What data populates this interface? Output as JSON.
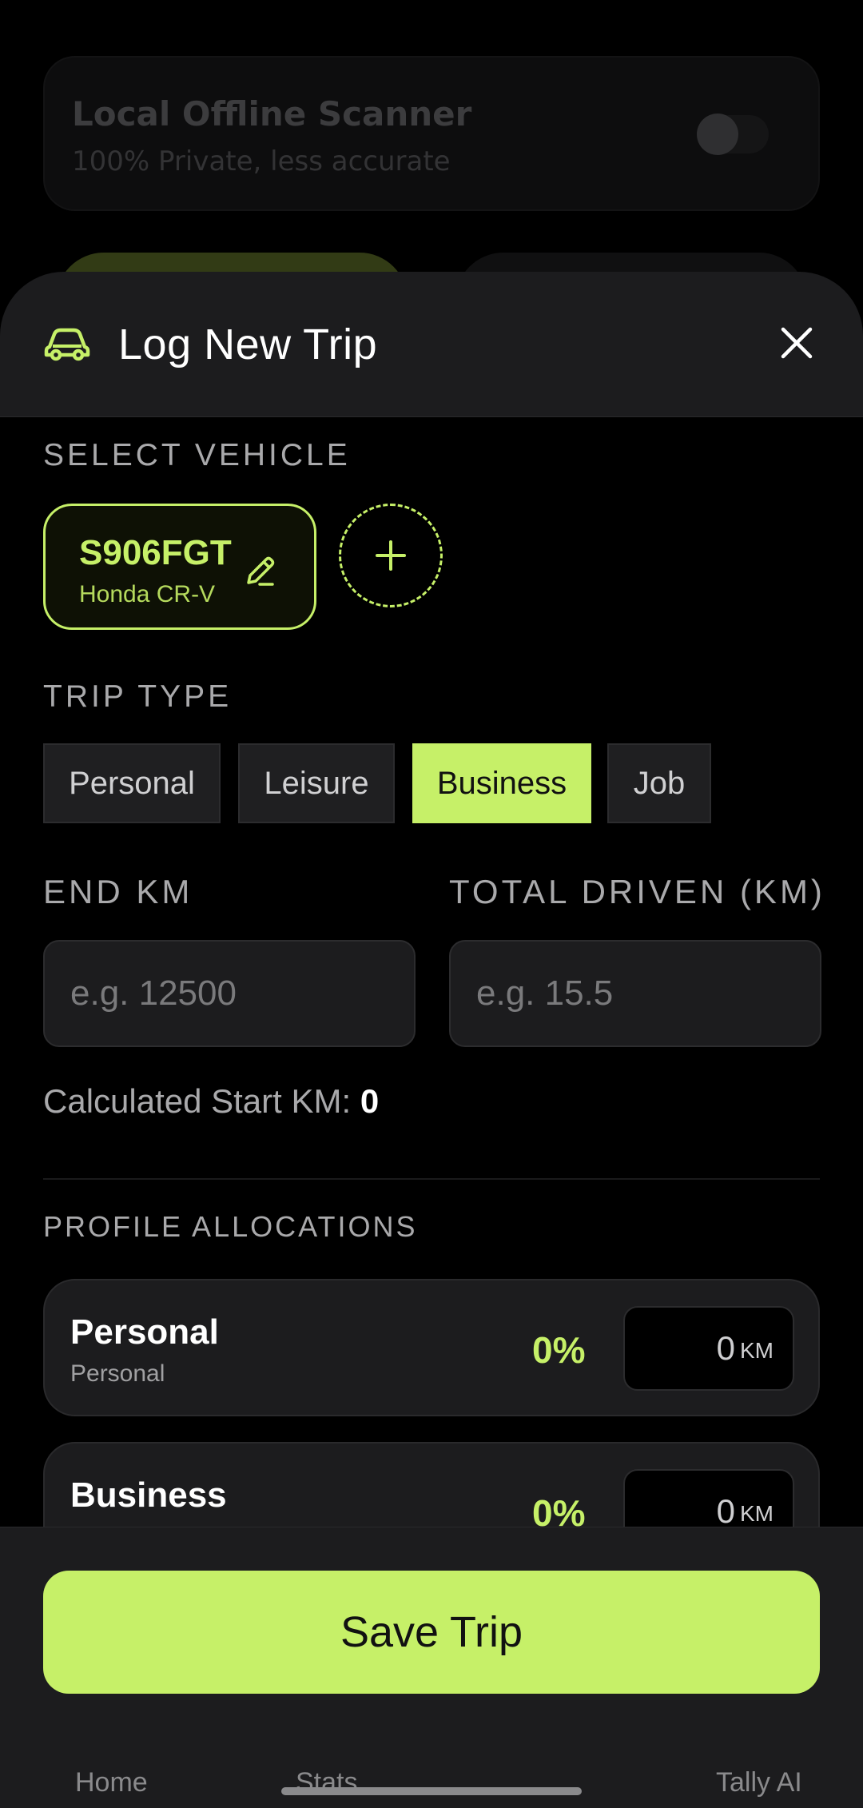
{
  "background": {
    "card_title": "Local Offline Scanner",
    "card_subtitle": "100% Private, less accurate"
  },
  "sheet": {
    "title": "Log New Trip",
    "icon": "car-icon",
    "close_icon": "close-icon"
  },
  "vehicle_section": {
    "label": "SELECT VEHICLE",
    "vehicles": [
      {
        "plate": "S906FGT",
        "model": "Honda CR-V",
        "selected": true
      }
    ],
    "add_icon": "plus-icon"
  },
  "trip_type": {
    "label": "TRIP TYPE",
    "options": [
      {
        "label": "Personal",
        "active": false
      },
      {
        "label": "Leisure",
        "active": false
      },
      {
        "label": "Business",
        "active": true
      },
      {
        "label": "Job",
        "active": false
      }
    ]
  },
  "km": {
    "end_label": "END KM",
    "end_placeholder": "e.g. 12500",
    "total_label": "TOTAL DRIVEN (KM)",
    "total_placeholder": "e.g. 15.5",
    "calc_label": "Calculated Start KM:",
    "calc_value": "0"
  },
  "profiles": {
    "label": "PROFILE ALLOCATIONS",
    "items": [
      {
        "name": "Personal",
        "subtitle": "Personal",
        "percent": "0%",
        "km": "0",
        "unit": "KM"
      },
      {
        "name": "Business",
        "subtitle": "",
        "percent": "0%",
        "km": "0",
        "unit": "KM"
      }
    ]
  },
  "footer": {
    "save_label": "Save Trip",
    "nav": [
      "Home",
      "Stats",
      "Tally AI"
    ]
  },
  "colors": {
    "accent": "#c6f068",
    "surface": "#1c1c1e",
    "background": "#000000"
  }
}
